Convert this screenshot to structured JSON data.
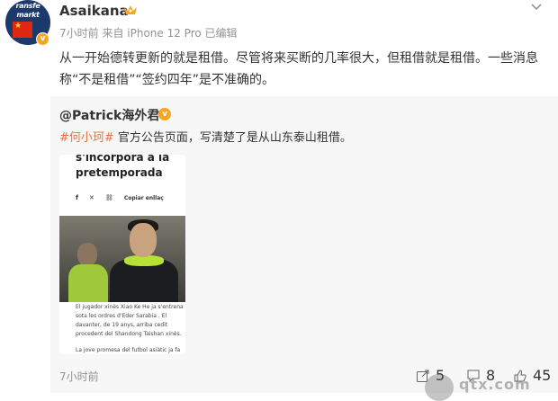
{
  "header": {
    "username": "Asaikana",
    "meta": "7小时前  来自 iPhone 12 Pro 已编辑",
    "avatar_text": "ransfe\nmarkt",
    "verified_letter": "v"
  },
  "post": {
    "text": "从一开始德转更新的就是租借。尽管将来买断的几率很大，但租借就是租借。一些消息称“不是租借”“签约四年”是不准确的。"
  },
  "repost": {
    "user": "@Patrick海外君",
    "verified_letter": "v",
    "tag": "#何小珂#",
    "text": " 官方公告页面，写清楚了是从山东泰山租借。",
    "card": {
      "title_line1": "s'incorpora a la",
      "title_line2": "pretemporada",
      "share_label": "Copiar enllaç",
      "body_p1": "El jugador xinès Xiao Ke He ja s'entrena sota les ordres d'Eder Sarabia . El davanter, de 19 anys, arriba cedit procedent del Shandong Taishan xinès.",
      "body_p2": "La jove promesa del futbol asiàtic ja fa"
    }
  },
  "footer": {
    "time": "7小时前",
    "shares": "5",
    "comments": "8",
    "likes": "45"
  },
  "watermark": {
    "text": "qtx.com"
  },
  "colors": {
    "tag": "#eb7340",
    "badge": "#f5a623",
    "meta": "#939393"
  }
}
